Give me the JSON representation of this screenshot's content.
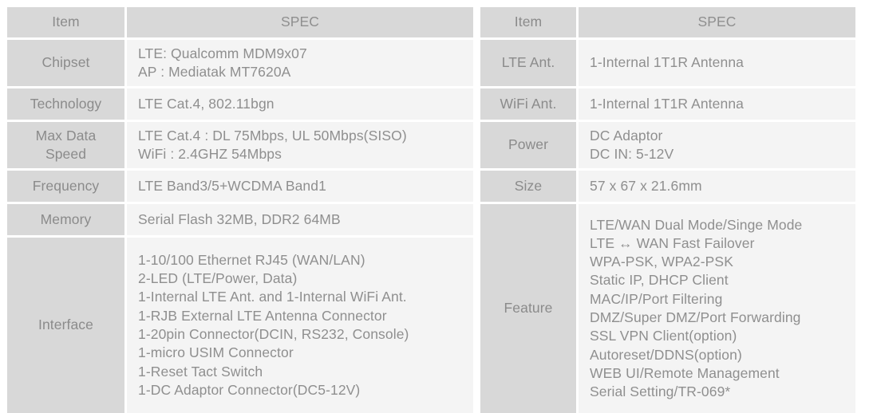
{
  "tables": {
    "left": {
      "header": {
        "item": "Item",
        "spec": "SPEC"
      },
      "rows": [
        {
          "item": "Chipset",
          "spec": "LTE: Qualcomm MDM9x07\nAP : Mediatak MT7620A"
        },
        {
          "item": "Technology",
          "spec": "LTE Cat.4, 802.11bgn"
        },
        {
          "item": "Max Data\nSpeed",
          "spec": "LTE Cat.4 : DL 75Mbps, UL 50Mbps(SISO)\nWiFi : 2.4GHZ 54Mbps"
        },
        {
          "item": "Frequency",
          "spec": "LTE Band3/5+WCDMA Band1"
        },
        {
          "item": "Memory",
          "spec": "Serial Flash 32MB, DDR2 64MB"
        },
        {
          "item": "Interface",
          "spec": "1-10/100 Ethernet RJ45 (WAN/LAN)\n2-LED (LTE/Power, Data)\n1-Internal LTE Ant. and 1-Internal WiFi Ant.\n1-RJB External LTE Antenna Connector\n1-20pin Connector(DCIN, RS232, Console)\n1-micro USIM Connector\n1-Reset Tact Switch\n1-DC Adaptor Connector(DC5-12V)"
        }
      ]
    },
    "right": {
      "header": {
        "item": "Item",
        "spec": "SPEC"
      },
      "rows": [
        {
          "item": "LTE Ant.",
          "spec": "1-Internal 1T1R Antenna"
        },
        {
          "item": "WiFi Ant.",
          "spec": "1-Internal 1T1R Antenna"
        },
        {
          "item": "Power",
          "spec": "DC Adaptor\nDC IN: 5-12V"
        },
        {
          "item": "Size",
          "spec": "57 x 67 x 21.6mm"
        },
        {
          "item": "Feature",
          "spec": "LTE/WAN Dual Mode/Singe Mode\nLTE ↔ WAN Fast Failover\nWPA-PSK, WPA2-PSK\nStatic IP, DHCP Client\nMAC/IP/Port Filtering\nDMZ/Super DMZ/Port Forwarding\nSSL VPN Client(option)\nAutoreset/DDNS(option)\nWEB UI/Remote Management\nSerial Setting/TR-069*"
        }
      ]
    }
  },
  "colors": {
    "item_background": "#d8d8d8",
    "spec_background": "#f4f4f4",
    "text": "#8d8d8d",
    "page_background": "#ffffff"
  }
}
